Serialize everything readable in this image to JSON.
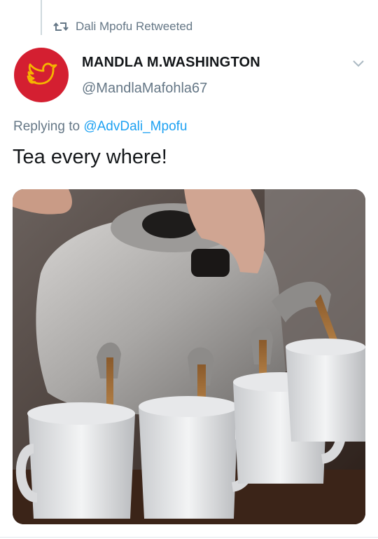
{
  "retweet": {
    "icon": "retweet-icon",
    "text": "Dali Mpofu Retweeted"
  },
  "author": {
    "display_name": "MANDLA M.WASHINGTON",
    "handle": "@MandlaMafohla67",
    "avatar_icon": "bird-logo-icon",
    "avatar_color": "#d41f31"
  },
  "reply": {
    "prefix": "Replying to ",
    "mention": "@AdvDali_Mpofu"
  },
  "tweet": {
    "text": "Tea every where!"
  },
  "media": {
    "type": "photo",
    "subject": "teapot-with-many-spouts-pouring-into-mugs"
  },
  "colors": {
    "link": "#1da1f2",
    "secondary_text": "#657786",
    "primary_text": "#14171a"
  }
}
